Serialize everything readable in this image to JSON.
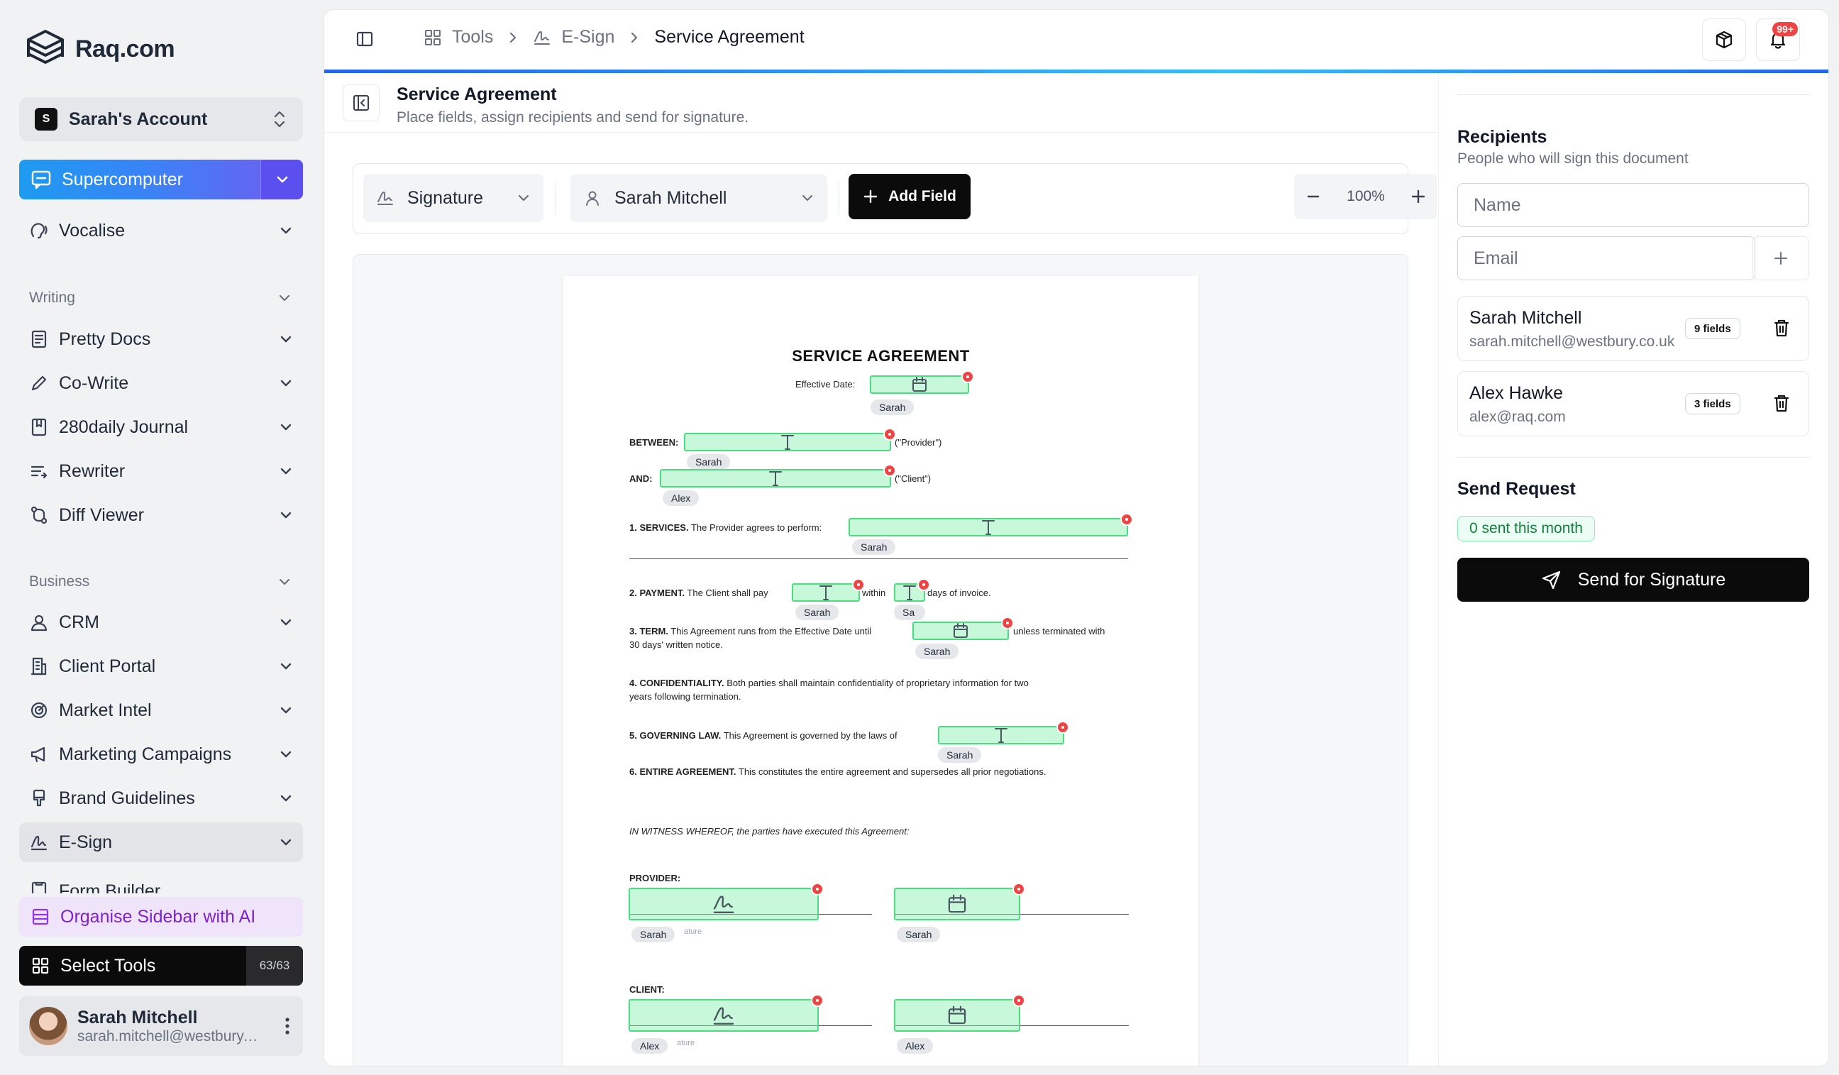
{
  "brand": {
    "name": "Raq.com"
  },
  "account": {
    "badge": "S",
    "name": "Sarah's Account"
  },
  "supercomputer": {
    "label": "Supercomputer"
  },
  "nav": {
    "vocalise": "Vocalise",
    "writing_section": "Writing",
    "writing_items": [
      "Pretty Docs",
      "Co-Write",
      "280daily Journal",
      "Rewriter",
      "Diff Viewer"
    ],
    "business_section": "Business",
    "business_items": [
      "CRM",
      "Client Portal",
      "Market Intel",
      "Marketing Campaigns",
      "Brand Guidelines",
      "E-Sign",
      "Form Builder"
    ]
  },
  "organise": {
    "label": "Organise Sidebar with AI"
  },
  "select_tools": {
    "label": "Select Tools",
    "count": "63/63"
  },
  "user": {
    "name": "Sarah Mitchell",
    "email": "sarah.mitchell@westbury.co.uk"
  },
  "breadcrumb": {
    "tools": "Tools",
    "esign": "E-Sign",
    "current": "Service Agreement"
  },
  "notifications": {
    "badge": "99+"
  },
  "doc_header": {
    "title": "Service Agreement",
    "subtitle": "Place fields, assign recipients and send for signature."
  },
  "toolbar": {
    "field_type": "Signature",
    "recipient": "Sarah Mitchell",
    "add_field": "Add Field",
    "zoom": "100%"
  },
  "document": {
    "title": "SERVICE AGREEMENT",
    "effective_date": "Effective Date:",
    "between": "BETWEEN:",
    "provider_suffix": "(\"Provider\")",
    "and": "AND:",
    "client_suffix": "(\"Client\")",
    "services_head": "1. SERVICES.",
    "services_text": "The Provider agrees to perform:",
    "payment_head": "2. PAYMENT.",
    "payment_text": "The Client shall pay",
    "payment_within": "within",
    "payment_days": "days of invoice.",
    "term_head": "3. TERM.",
    "term_text": "This Agreement runs from the Effective Date until",
    "term_suffix": "unless terminated with",
    "term_line2": "30 days' written notice.",
    "conf_head": "4. CONFIDENTIALITY.",
    "conf_text": "Both parties shall maintain confidentiality of proprietary information for two",
    "conf_line2": "years following termination.",
    "law_head": "5. GOVERNING LAW.",
    "law_text": "This Agreement is governed by the laws of",
    "entire_head": "6. ENTIRE AGREEMENT.",
    "entire_text": "This constitutes the entire agreement and supersedes all prior negotiations.",
    "witness": "IN WITNESS WHEREOF, the parties have executed this Agreement:",
    "provider_label": "PROVIDER:",
    "client_label": "CLIENT:",
    "ghost_signature": "ature",
    "tags": {
      "sarah": "Sarah",
      "alex": "Alex",
      "sa": "Sa"
    }
  },
  "recipients_panel": {
    "title": "Recipients",
    "subtitle": "People who will sign this document",
    "name_placeholder": "Name",
    "email_placeholder": "Email",
    "list": [
      {
        "name": "Sarah Mitchell",
        "email": "sarah.mitchell@westbury.co.uk",
        "fields": "9 fields"
      },
      {
        "name": "Alex Hawke",
        "email": "alex@raq.com",
        "fields": "3 fields"
      }
    ]
  },
  "send_request": {
    "title": "Send Request",
    "sent_badge": "0 sent this month",
    "button": "Send for Signature"
  },
  "colors": {
    "accent": "#3b82f6",
    "field_fill": "#bbf7d0",
    "field_border": "#4ade80",
    "required_dot": "#ef4444",
    "organise_bg": "#f0e4fb"
  }
}
